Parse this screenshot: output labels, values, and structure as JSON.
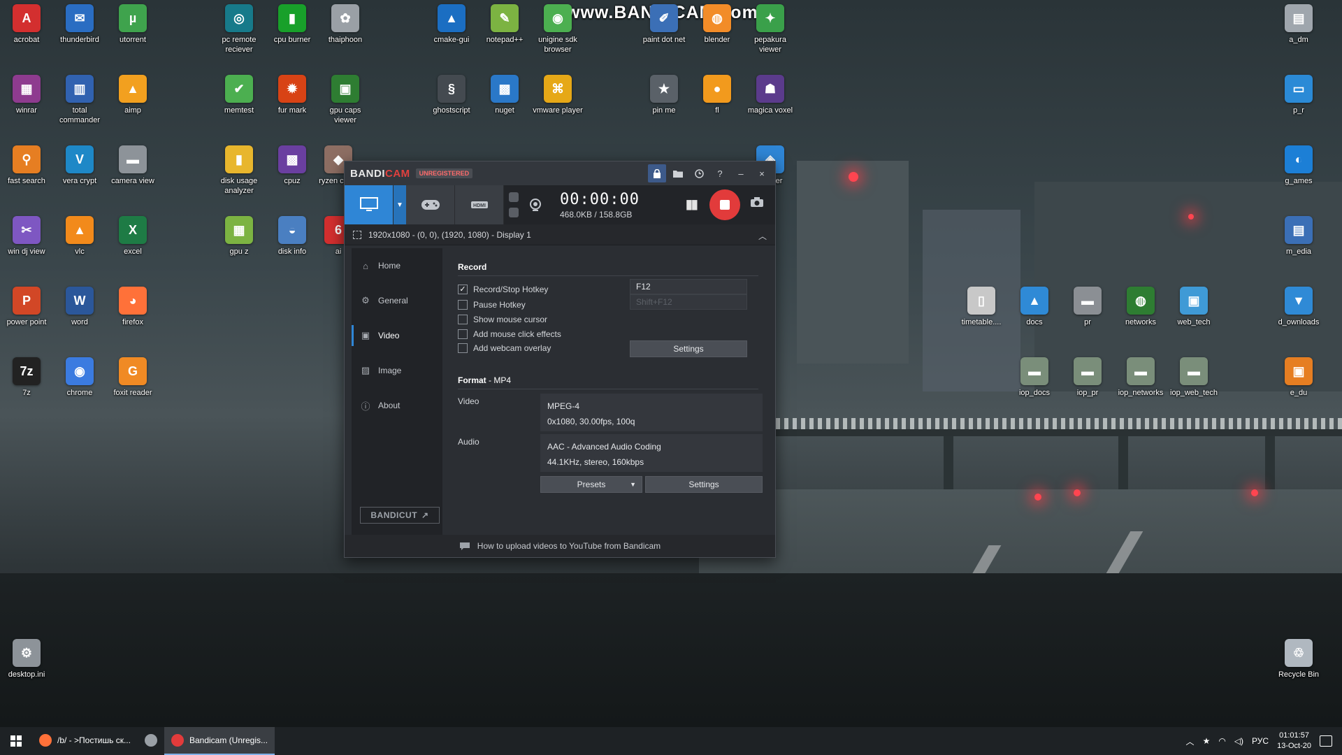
{
  "watermark": "www.BANDICAM.com",
  "desktop": {
    "icons": [
      {
        "label": "acrobat",
        "glyph": "A",
        "color": "#d32f2f"
      },
      {
        "label": "thunderbird",
        "glyph": "✉",
        "color": "#2a6dc2"
      },
      {
        "label": "utorrent",
        "glyph": "µ",
        "color": "#3fa34d"
      },
      {
        "label": "pc remote reciever",
        "glyph": "◎",
        "color": "#177a8a"
      },
      {
        "label": "cpu burner",
        "glyph": "▮",
        "color": "#18a02a"
      },
      {
        "label": "thaiphoon",
        "glyph": "✿",
        "color": "#9aa0a6"
      },
      {
        "label": "cmake-gui",
        "glyph": "▲",
        "color": "#1b6ec2"
      },
      {
        "label": "notepad++",
        "glyph": "✎",
        "color": "#7cb342"
      },
      {
        "label": "unigine sdk browser",
        "glyph": "◉",
        "color": "#4caf50"
      },
      {
        "label": "paint dot net",
        "glyph": "✐",
        "color": "#3b6fb6"
      },
      {
        "label": "blender",
        "glyph": "◍",
        "color": "#f28c28"
      },
      {
        "label": "pepakura viewer",
        "glyph": "✦",
        "color": "#3aa04a"
      },
      {
        "label": "a_dm",
        "glyph": "▤",
        "color": "#9fa6ad"
      },
      {
        "label": "winrar",
        "glyph": "▦",
        "color": "#8e3b8f"
      },
      {
        "label": "total commander",
        "glyph": "▥",
        "color": "#3162b0"
      },
      {
        "label": "aimp",
        "glyph": "▲",
        "color": "#f2a01f"
      },
      {
        "label": "memtest",
        "glyph": "✔",
        "color": "#4caf50"
      },
      {
        "label": "fur mark",
        "glyph": "✹",
        "color": "#d84315"
      },
      {
        "label": "gpu caps viewer",
        "glyph": "▣",
        "color": "#2e7d32"
      },
      {
        "label": "ghostscript",
        "glyph": "§",
        "color": "#444a50"
      },
      {
        "label": "nuget",
        "glyph": "▩",
        "color": "#2a78c8"
      },
      {
        "label": "vmware player",
        "glyph": "⌘",
        "color": "#e6a817"
      },
      {
        "label": "pin me",
        "glyph": "★",
        "color": "#5a6168"
      },
      {
        "label": "fl",
        "glyph": "●",
        "color": "#f29a1d"
      },
      {
        "label": "magica voxel",
        "glyph": "☗",
        "color": "#5b3b8c"
      },
      {
        "label": "p_r",
        "glyph": "▭",
        "color": "#2b8ad6"
      },
      {
        "label": "fast search",
        "glyph": "⚲",
        "color": "#e67e22"
      },
      {
        "label": "vera crypt",
        "glyph": "V",
        "color": "#1e88c7"
      },
      {
        "label": "camera view",
        "glyph": "▬",
        "color": "#8d9399"
      },
      {
        "label": "disk usage analyzer",
        "glyph": "▮",
        "color": "#e8b62d"
      },
      {
        "label": "cpuz",
        "glyph": "▩",
        "color": "#6a3fa0"
      },
      {
        "label": "ryzen calcu",
        "glyph": "◆",
        "color": "#8d6e63"
      },
      {
        "label": "ura ner",
        "glyph": "◈",
        "color": "#2f86d6"
      },
      {
        "label": "g_ames",
        "glyph": "◐",
        "color": "#1c7fd6"
      },
      {
        "label": "win dj view",
        "glyph": "✂",
        "color": "#7e57c2"
      },
      {
        "label": "vlc",
        "glyph": "▲",
        "color": "#f28a1b"
      },
      {
        "label": "excel",
        "glyph": "X",
        "color": "#1e7b45"
      },
      {
        "label": "gpu z",
        "glyph": "▦",
        "color": "#7cb342"
      },
      {
        "label": "disk info",
        "glyph": "◒",
        "color": "#4a7fc1"
      },
      {
        "label": "ai",
        "glyph": "6",
        "color": "#d32f2f"
      },
      {
        "label": "m_edia",
        "glyph": "▤",
        "color": "#3b6fb6"
      },
      {
        "label": "power point",
        "glyph": "P",
        "color": "#d24726"
      },
      {
        "label": "word",
        "glyph": "W",
        "color": "#2b579a"
      },
      {
        "label": "firefox",
        "glyph": "◕",
        "color": "#ff7139"
      },
      {
        "label": "timetable....",
        "glyph": "▯",
        "color": "#c8c8c8"
      },
      {
        "label": "docs",
        "glyph": "▲",
        "color": "#2f8ad6"
      },
      {
        "label": "pr",
        "glyph": "▬",
        "color": "#8b8f94"
      },
      {
        "label": "networks",
        "glyph": "◍",
        "color": "#2e7d32"
      },
      {
        "label": "web_tech",
        "glyph": "▣",
        "color": "#3f9ad6"
      },
      {
        "label": "d_ownloads",
        "glyph": "▼",
        "color": "#2f8ad6"
      },
      {
        "label": "7z",
        "glyph": "7z",
        "color": "#222"
      },
      {
        "label": "chrome",
        "glyph": "◉",
        "color": "#3b7be0"
      },
      {
        "label": "foxit reader",
        "glyph": "G",
        "color": "#f08a24"
      },
      {
        "label": "iop_docs",
        "glyph": "▬",
        "color": "#7a8e7a"
      },
      {
        "label": "iop_pr",
        "glyph": "▬",
        "color": "#7a8e7a"
      },
      {
        "label": "iop_networks",
        "glyph": "▬",
        "color": "#7a8e7a"
      },
      {
        "label": "iop_web_tech",
        "glyph": "▬",
        "color": "#7a8e7a"
      },
      {
        "label": "e_du",
        "glyph": "▣",
        "color": "#e67e22"
      },
      {
        "label": "desktop.ini",
        "glyph": "⚙",
        "color": "#8d9399"
      },
      {
        "label": "Recycle Bin",
        "glyph": "♲",
        "color": "#b0b8c0"
      }
    ]
  },
  "bandicam": {
    "title_brand_a": "BANDI",
    "title_brand_b": "CAM",
    "unregistered": "UNREGISTERED",
    "title_buttons": {
      "lock": "lock-icon",
      "folder": "folder-icon",
      "clock": "clock-icon",
      "help": "?",
      "minimize": "–",
      "close": "×"
    },
    "timer": "00:00:00",
    "size": "468.0KB / 158.8GB",
    "area": "1920x1080 - (0, 0), (1920, 1080) - Display 1",
    "sidebar": [
      {
        "label": "Home",
        "icon": "home-icon",
        "glyph": "⌂"
      },
      {
        "label": "General",
        "icon": "gear-icon",
        "glyph": "⚙"
      },
      {
        "label": "Video",
        "icon": "video-icon",
        "glyph": "▣"
      },
      {
        "label": "Image",
        "icon": "image-icon",
        "glyph": "▨"
      },
      {
        "label": "About",
        "icon": "info-icon",
        "glyph": "ⓘ"
      }
    ],
    "active_tab": "Video",
    "bandicut": "BANDICUT",
    "record": {
      "title": "Record",
      "options": [
        {
          "label": "Record/Stop Hotkey",
          "checked": true
        },
        {
          "label": "Pause Hotkey",
          "checked": false
        },
        {
          "label": "Show mouse cursor",
          "checked": false
        },
        {
          "label": "Add mouse click effects",
          "checked": false
        },
        {
          "label": "Add webcam overlay",
          "checked": false
        }
      ],
      "hotkey_record": "F12",
      "hotkey_pause": "Shift+F12",
      "settings": "Settings"
    },
    "format": {
      "title": "Format",
      "container": "MP4",
      "video_label": "Video",
      "video_line1": "MPEG-4",
      "video_line2": "0x1080, 30.00fps, 100q",
      "audio_label": "Audio",
      "audio_line1": "AAC - Advanced Audio Coding",
      "audio_line2": "44.1KHz, stereo, 160kbps",
      "presets": "Presets",
      "settings": "Settings"
    },
    "footer": "How to upload videos to YouTube from Bandicam"
  },
  "taskbar": {
    "tasks": [
      {
        "label": "/b/ - >Постишь ск...",
        "icon": "firefox-icon",
        "color": "#ff7139",
        "active": false
      },
      {
        "label": "",
        "icon": "app-icon",
        "color": "#9aa0a6",
        "active": false
      },
      {
        "label": "Bandicam (Unregis...",
        "icon": "bandicam-icon",
        "color": "#e23b3b",
        "active": true
      }
    ],
    "lang": "РУС",
    "time": "01:01:57",
    "date": "13-Oct-20"
  }
}
